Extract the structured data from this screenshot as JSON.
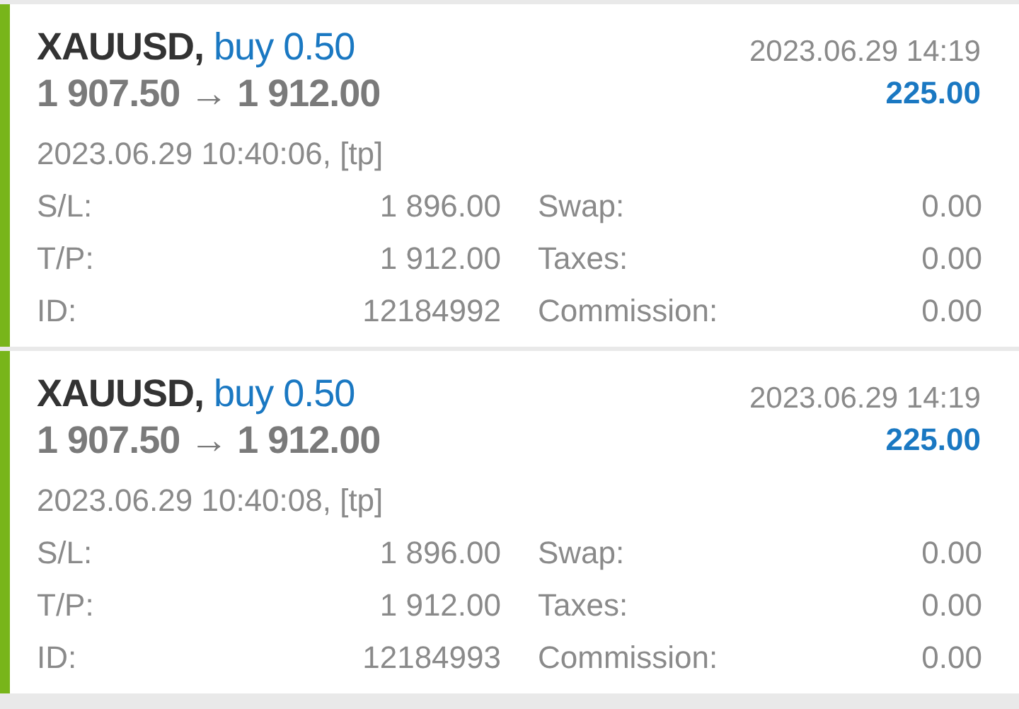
{
  "trades": [
    {
      "symbol": "XAUUSD,",
      "side": "buy 0.50",
      "prices": "1 907.50 → 1 912.00",
      "close_time": "2023.06.29 14:19",
      "profit": "225.00",
      "open_time": "2023.06.29 10:40:06, [tp]",
      "details": [
        {
          "label": "S/L:",
          "value": "1 896.00"
        },
        {
          "label": "Swap:",
          "value": "0.00"
        },
        {
          "label": "T/P:",
          "value": "1 912.00"
        },
        {
          "label": "Taxes:",
          "value": "0.00"
        },
        {
          "label": "ID:",
          "value": "12184992"
        },
        {
          "label": "Commission:",
          "value": "0.00"
        }
      ]
    },
    {
      "symbol": "XAUUSD,",
      "side": "buy 0.50",
      "prices": "1 907.50 → 1 912.00",
      "close_time": "2023.06.29 14:19",
      "profit": "225.00",
      "open_time": "2023.06.29 10:40:08, [tp]",
      "details": [
        {
          "label": "S/L:",
          "value": "1 896.00"
        },
        {
          "label": "Swap:",
          "value": "0.00"
        },
        {
          "label": "T/P:",
          "value": "1 912.00"
        },
        {
          "label": "Taxes:",
          "value": "0.00"
        },
        {
          "label": "ID:",
          "value": "12184993"
        },
        {
          "label": "Commission:",
          "value": "0.00"
        }
      ]
    }
  ]
}
